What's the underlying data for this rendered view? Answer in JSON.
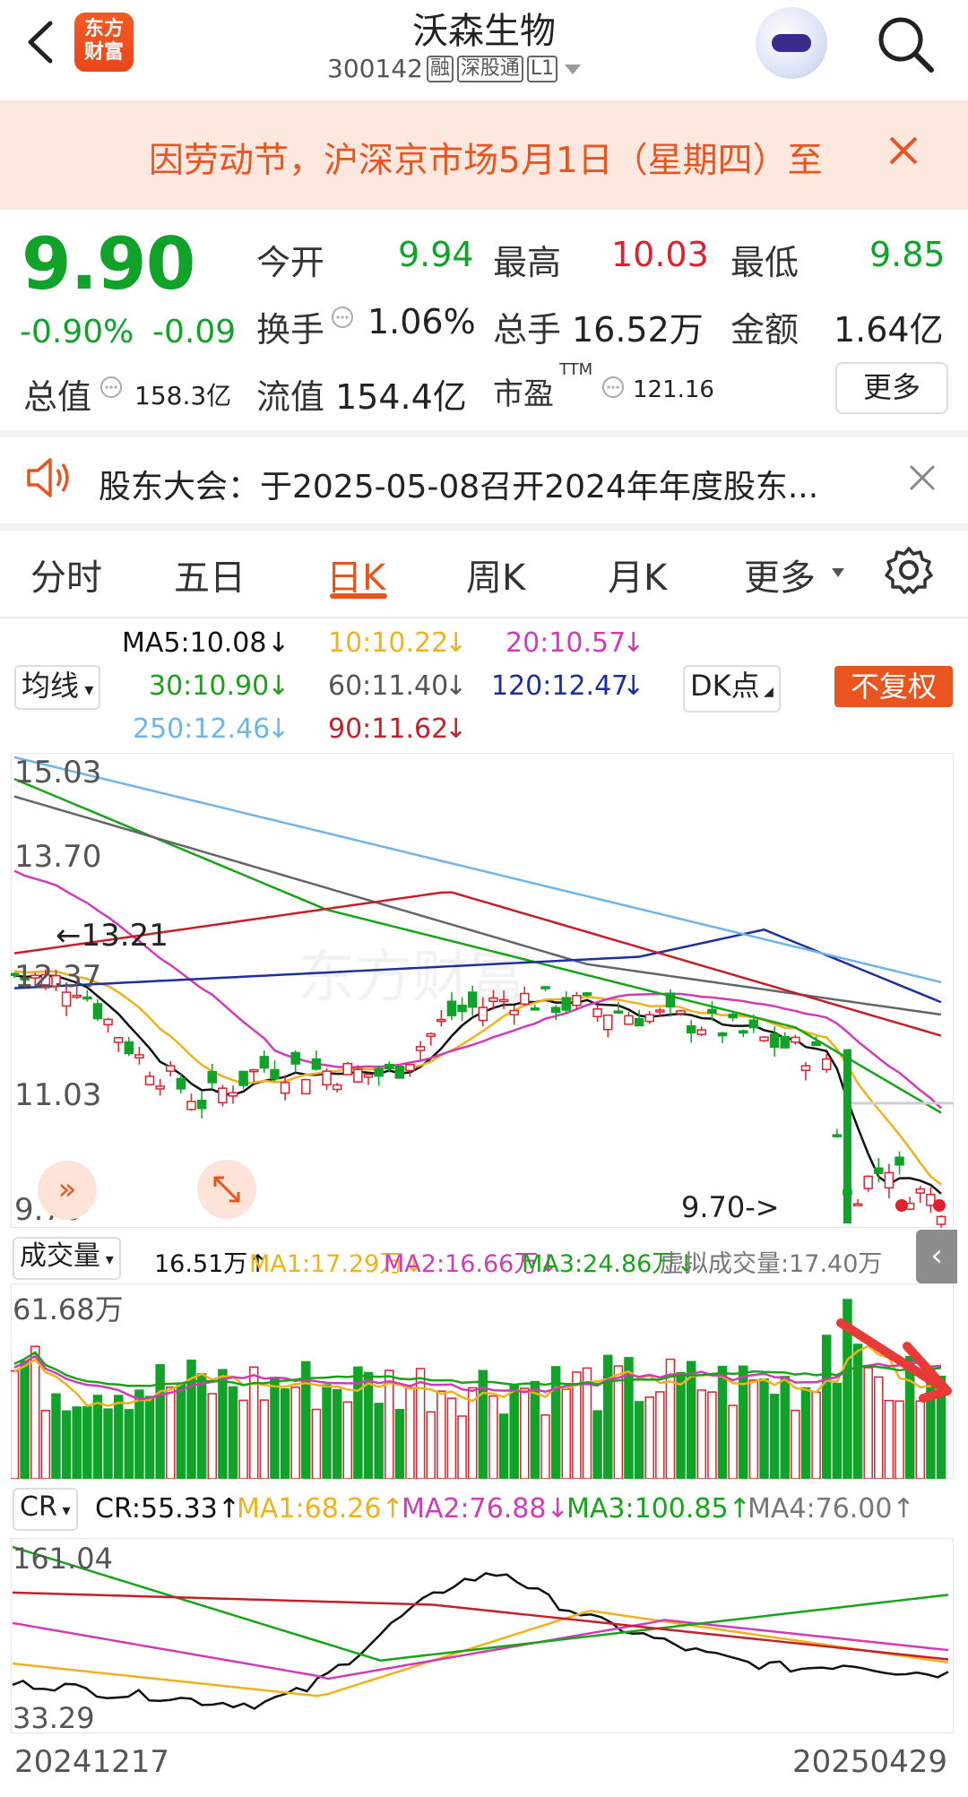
{
  "header": {
    "title": "沃森生物",
    "code": "300142",
    "tags": [
      "融",
      "深股通",
      "L1"
    ]
  },
  "notice": {
    "text": "因劳动节，沪深京市场5月1日（星期四）至"
  },
  "quote": {
    "price": "9.90",
    "change_pct": "-0.90%",
    "change_amt": "-0.09",
    "open_label": "今开",
    "open": "9.94",
    "high_label": "最高",
    "high": "10.03",
    "low_label": "最低",
    "low": "9.85",
    "turnover_label": "换手",
    "turnover": "1.06%",
    "volume_label": "总手",
    "volume": "16.52万",
    "amount_label": "金额",
    "amount": "1.64亿",
    "mktcap_label": "总值",
    "mktcap": "158.3亿",
    "float_label": "流值",
    "float": "154.4亿",
    "pe_label": "市盈",
    "pe_sup": "TTM",
    "pe": "121.16",
    "more_label": "更多"
  },
  "announcement": {
    "text": "股东大会：于2025-05-08召开2024年年度股东..."
  },
  "tabs": [
    "分时",
    "五日",
    "日K",
    "周K",
    "月K",
    "更多"
  ],
  "active_tab": "日K",
  "ma_legend": {
    "selector": "均线",
    "ma5": "MA5:10.08",
    "ma10": "10:10.22",
    "ma20": "20:10.57",
    "ma30": "30:10.90",
    "ma60": "60:11.40",
    "ma120": "120:12.47",
    "ma250": "250:12.46",
    "ma90": "90:11.62",
    "dk": "DK点",
    "fq": "不复权"
  },
  "kline": {
    "y_labels": [
      "15.03",
      "13.70",
      "12.37",
      "11.03",
      "9.70"
    ],
    "max_marker": "13.21",
    "min_marker": "9.70->"
  },
  "volume": {
    "selector": "成交量",
    "vol": "16.51万",
    "ma1": "MA1:17.29万",
    "ma2": "MA2:16.66万",
    "ma3": "MA3:24.86万",
    "virtual": "虚拟成交量:17.40万",
    "y_max": "61.68万"
  },
  "cr": {
    "selector": "CR",
    "cr": "CR:55.33",
    "ma1": "MA1:68.26",
    "ma2": "MA2:76.88",
    "ma3": "MA3:100.85",
    "ma4": "MA4:76.00",
    "y_max": "161.04",
    "y_min": "33.29"
  },
  "dates": {
    "start": "20241217",
    "end": "20250429"
  },
  "colors": {
    "up": "#e0202d",
    "down": "#11a22a",
    "accent": "#e9541f",
    "ma5": "#111111",
    "ma10": "#f0b21c",
    "ma20": "#d23bb8",
    "ma30": "#18a418",
    "ma60": "#666666",
    "ma120": "#1d2fa0",
    "ma250": "#6db5ea",
    "ma90": "#c4202a"
  }
}
